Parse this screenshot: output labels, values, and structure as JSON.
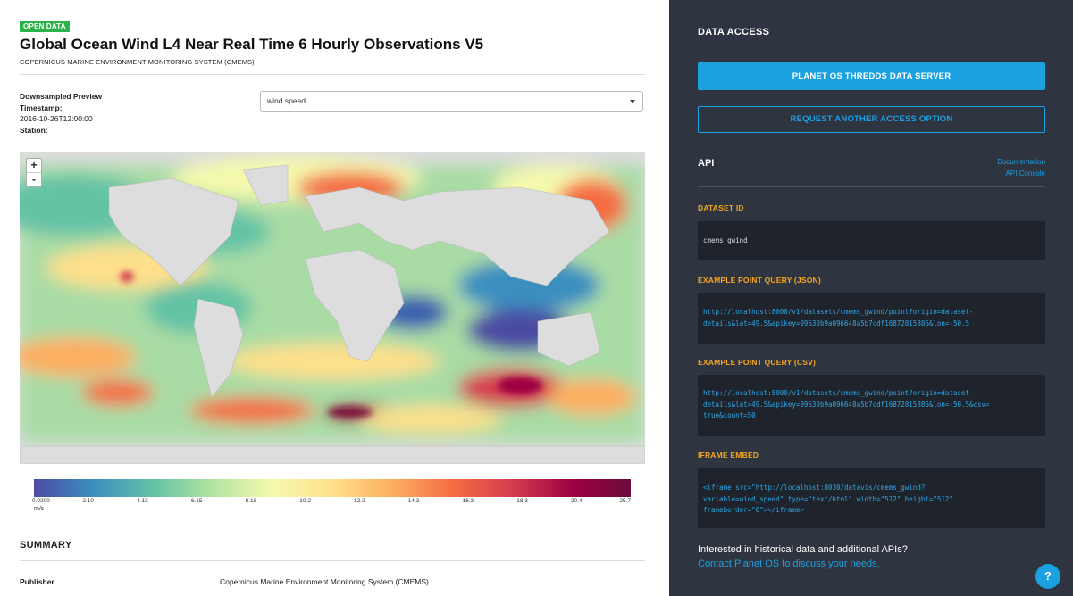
{
  "badge": "OPEN DATA",
  "title": "Global Ocean Wind L4 Near Real Time 6 Hourly Observations V5",
  "subtitle": "COPERNICUS MARINE ENVIRONMENT MONITORING SYSTEM (CMEMS)",
  "preview": {
    "heading": "Downsampled Preview",
    "timestamp_label": "Timestamp:",
    "timestamp_value": "2016-10-26T12:00:00",
    "station_label": "Station:"
  },
  "variable_select": {
    "value": "wind speed"
  },
  "map": {
    "zoom_in": "+",
    "zoom_out": "-"
  },
  "colorbar": {
    "ticks": [
      "0.0200",
      "2.10",
      "4.13",
      "6.15",
      "8.18",
      "10.2",
      "12.2",
      "14.3",
      "16.3",
      "18.3",
      "20.4",
      "25.7"
    ],
    "unit": "m/s",
    "colors": [
      "#4b4ba3",
      "#3b8fc0",
      "#63c3a5",
      "#b5e3a1",
      "#f4f9ad",
      "#fee08b",
      "#fdae61",
      "#f46d43",
      "#d53e4f",
      "#9e0142",
      "#6d0a3c"
    ]
  },
  "summary": {
    "heading": "SUMMARY",
    "publisher_label": "Publisher",
    "publisher_value": "Copernicus Marine Environment Monitoring System (CMEMS)"
  },
  "data_access": {
    "heading": "DATA ACCESS",
    "primary_button": "PLANET OS THREDDS DATA SERVER",
    "secondary_button": "REQUEST ANOTHER ACCESS OPTION"
  },
  "api": {
    "heading": "API",
    "documentation_link": "Documentation",
    "console_link": "API Console",
    "dataset_id_label": "DATASET ID",
    "dataset_id": "cmems_gwind",
    "json_label": "EXAMPLE POINT QUERY (JSON)",
    "json_lines": [
      "http://localhost:8000/v1/datasets/cmems_gwind/point?origin=dataset-",
      "details&lat=49.5&apikey=09630b9a096648a5b7cdf16872815886&lon=-50.5"
    ],
    "csv_label": "EXAMPLE POINT QUERY (CSV)",
    "csv_lines": [
      "http://localhost:8000/v1/datasets/cmems_gwind/point?origin=dataset-",
      "details&lat=49.5&apikey=09630b9a096648a5b7cdf16872815886&lon=-50.5&csv=",
      "true&count=50"
    ],
    "iframe_label": "IFRAME EMBED",
    "iframe_lines": [
      "<iframe src=\"http://localhost:8030/datavis/cmems_gwind?",
      "variable=wind_speed\" type=\"text/html\" width=\"512\" height=\"512\"",
      "frameborder=\"0\"></iframe>"
    ]
  },
  "footer": {
    "interest": "Interested in historical data and additional APIs?",
    "contact": "Contact Planet OS to discuss your needs.",
    "help_icon": "?"
  }
}
